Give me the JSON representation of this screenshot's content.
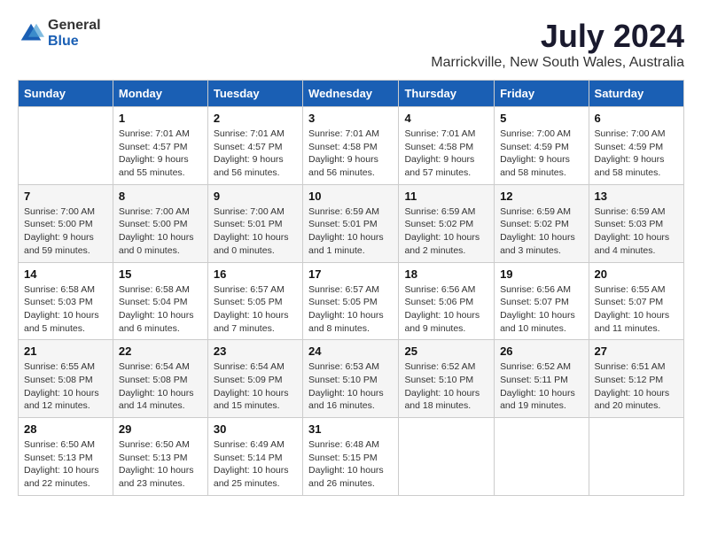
{
  "logo": {
    "general": "General",
    "blue": "Blue"
  },
  "title": "July 2024",
  "location": "Marrickville, New South Wales, Australia",
  "days_of_week": [
    "Sunday",
    "Monday",
    "Tuesday",
    "Wednesday",
    "Thursday",
    "Friday",
    "Saturday"
  ],
  "weeks": [
    [
      {
        "day": "",
        "info": ""
      },
      {
        "day": "1",
        "info": "Sunrise: 7:01 AM\nSunset: 4:57 PM\nDaylight: 9 hours\nand 55 minutes."
      },
      {
        "day": "2",
        "info": "Sunrise: 7:01 AM\nSunset: 4:57 PM\nDaylight: 9 hours\nand 56 minutes."
      },
      {
        "day": "3",
        "info": "Sunrise: 7:01 AM\nSunset: 4:58 PM\nDaylight: 9 hours\nand 56 minutes."
      },
      {
        "day": "4",
        "info": "Sunrise: 7:01 AM\nSunset: 4:58 PM\nDaylight: 9 hours\nand 57 minutes."
      },
      {
        "day": "5",
        "info": "Sunrise: 7:00 AM\nSunset: 4:59 PM\nDaylight: 9 hours\nand 58 minutes."
      },
      {
        "day": "6",
        "info": "Sunrise: 7:00 AM\nSunset: 4:59 PM\nDaylight: 9 hours\nand 58 minutes."
      }
    ],
    [
      {
        "day": "7",
        "info": "Sunrise: 7:00 AM\nSunset: 5:00 PM\nDaylight: 9 hours\nand 59 minutes."
      },
      {
        "day": "8",
        "info": "Sunrise: 7:00 AM\nSunset: 5:00 PM\nDaylight: 10 hours\nand 0 minutes."
      },
      {
        "day": "9",
        "info": "Sunrise: 7:00 AM\nSunset: 5:01 PM\nDaylight: 10 hours\nand 0 minutes."
      },
      {
        "day": "10",
        "info": "Sunrise: 6:59 AM\nSunset: 5:01 PM\nDaylight: 10 hours\nand 1 minute."
      },
      {
        "day": "11",
        "info": "Sunrise: 6:59 AM\nSunset: 5:02 PM\nDaylight: 10 hours\nand 2 minutes."
      },
      {
        "day": "12",
        "info": "Sunrise: 6:59 AM\nSunset: 5:02 PM\nDaylight: 10 hours\nand 3 minutes."
      },
      {
        "day": "13",
        "info": "Sunrise: 6:59 AM\nSunset: 5:03 PM\nDaylight: 10 hours\nand 4 minutes."
      }
    ],
    [
      {
        "day": "14",
        "info": "Sunrise: 6:58 AM\nSunset: 5:03 PM\nDaylight: 10 hours\nand 5 minutes."
      },
      {
        "day": "15",
        "info": "Sunrise: 6:58 AM\nSunset: 5:04 PM\nDaylight: 10 hours\nand 6 minutes."
      },
      {
        "day": "16",
        "info": "Sunrise: 6:57 AM\nSunset: 5:05 PM\nDaylight: 10 hours\nand 7 minutes."
      },
      {
        "day": "17",
        "info": "Sunrise: 6:57 AM\nSunset: 5:05 PM\nDaylight: 10 hours\nand 8 minutes."
      },
      {
        "day": "18",
        "info": "Sunrise: 6:56 AM\nSunset: 5:06 PM\nDaylight: 10 hours\nand 9 minutes."
      },
      {
        "day": "19",
        "info": "Sunrise: 6:56 AM\nSunset: 5:07 PM\nDaylight: 10 hours\nand 10 minutes."
      },
      {
        "day": "20",
        "info": "Sunrise: 6:55 AM\nSunset: 5:07 PM\nDaylight: 10 hours\nand 11 minutes."
      }
    ],
    [
      {
        "day": "21",
        "info": "Sunrise: 6:55 AM\nSunset: 5:08 PM\nDaylight: 10 hours\nand 12 minutes."
      },
      {
        "day": "22",
        "info": "Sunrise: 6:54 AM\nSunset: 5:08 PM\nDaylight: 10 hours\nand 14 minutes."
      },
      {
        "day": "23",
        "info": "Sunrise: 6:54 AM\nSunset: 5:09 PM\nDaylight: 10 hours\nand 15 minutes."
      },
      {
        "day": "24",
        "info": "Sunrise: 6:53 AM\nSunset: 5:10 PM\nDaylight: 10 hours\nand 16 minutes."
      },
      {
        "day": "25",
        "info": "Sunrise: 6:52 AM\nSunset: 5:10 PM\nDaylight: 10 hours\nand 18 minutes."
      },
      {
        "day": "26",
        "info": "Sunrise: 6:52 AM\nSunset: 5:11 PM\nDaylight: 10 hours\nand 19 minutes."
      },
      {
        "day": "27",
        "info": "Sunrise: 6:51 AM\nSunset: 5:12 PM\nDaylight: 10 hours\nand 20 minutes."
      }
    ],
    [
      {
        "day": "28",
        "info": "Sunrise: 6:50 AM\nSunset: 5:13 PM\nDaylight: 10 hours\nand 22 minutes."
      },
      {
        "day": "29",
        "info": "Sunrise: 6:50 AM\nSunset: 5:13 PM\nDaylight: 10 hours\nand 23 minutes."
      },
      {
        "day": "30",
        "info": "Sunrise: 6:49 AM\nSunset: 5:14 PM\nDaylight: 10 hours\nand 25 minutes."
      },
      {
        "day": "31",
        "info": "Sunrise: 6:48 AM\nSunset: 5:15 PM\nDaylight: 10 hours\nand 26 minutes."
      },
      {
        "day": "",
        "info": ""
      },
      {
        "day": "",
        "info": ""
      },
      {
        "day": "",
        "info": ""
      }
    ]
  ]
}
